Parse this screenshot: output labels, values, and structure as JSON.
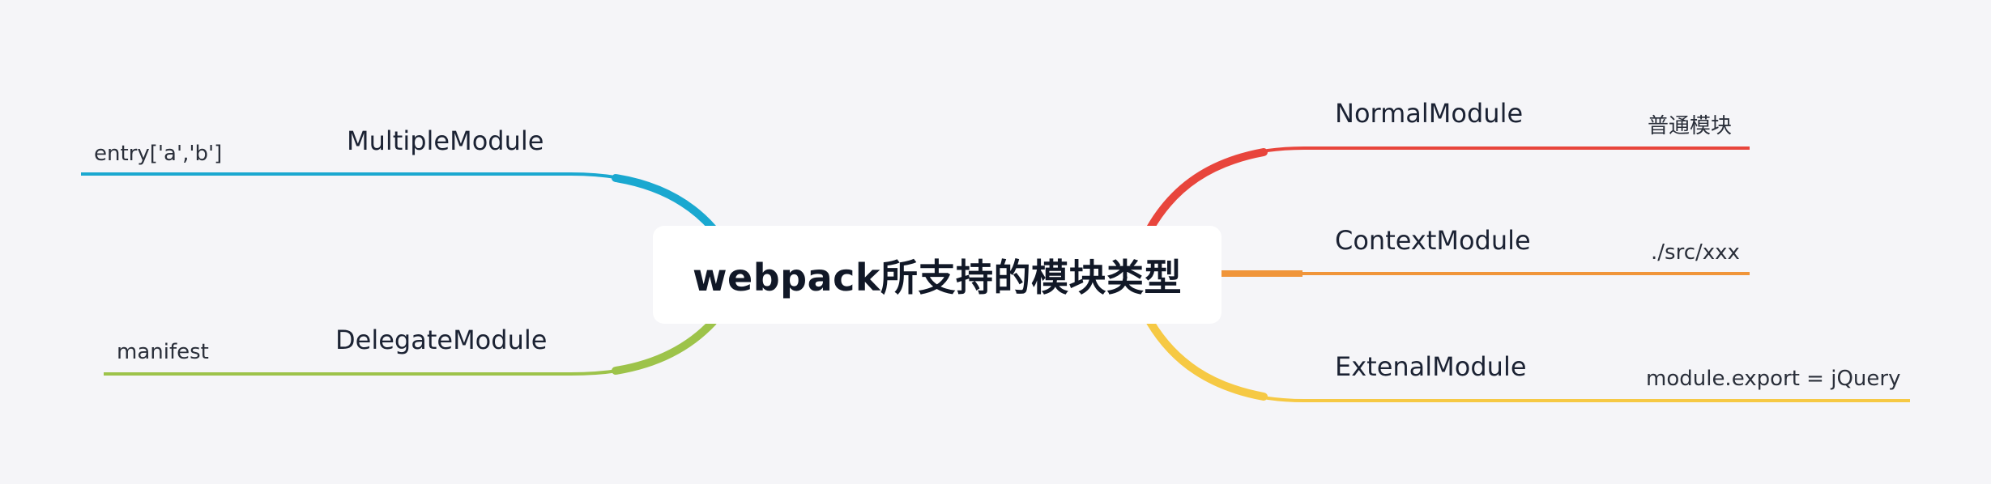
{
  "root": {
    "label": "webpack所支持的模块类型"
  },
  "branches": {
    "normal": {
      "label": "NormalModule",
      "detail": "普通模块",
      "color": "#e8453c"
    },
    "context": {
      "label": "ContextModule",
      "detail": "./src/xxx",
      "color": "#f0953a"
    },
    "external": {
      "label": "ExtenalModule",
      "detail": "module.export = jQuery",
      "color": "#f6c944"
    },
    "multiple": {
      "label": "MultipleModule",
      "detail": "entry['a','b']",
      "color": "#1aa8d0"
    },
    "delegate": {
      "label": "DelegateModule",
      "detail": "manifest",
      "color": "#9dc34a"
    }
  }
}
